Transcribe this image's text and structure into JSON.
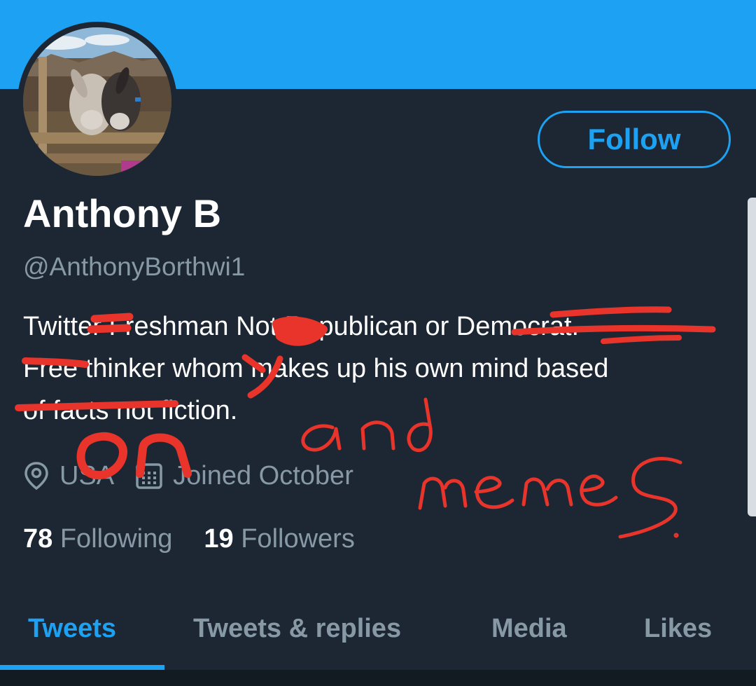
{
  "profile": {
    "display_name": "Anthony B",
    "handle": "@AnthonyBorthwi1",
    "bio_lines": [
      "Twitter Freshman Not Republican or Democrat.",
      "Free thinker whom makes up his own mind based",
      "of facts not fiction."
    ],
    "location": "USA",
    "joined": "Joined October",
    "location_icon": "map-pin-icon",
    "calendar_icon": "calendar-icon"
  },
  "actions": {
    "follow_label": "Follow"
  },
  "stats": {
    "following_count": "78",
    "following_label": "Following",
    "followers_count": "19",
    "followers_label": "Followers"
  },
  "tabs": [
    {
      "label": "Tweets",
      "active": true
    },
    {
      "label": "Tweets & replies",
      "active": false
    },
    {
      "label": "Media",
      "active": false
    },
    {
      "label": "Likes",
      "active": false
    }
  ],
  "handwriting": {
    "word_on": "on",
    "word_and": "and",
    "word_memes": "memes.",
    "color": "#e8342a"
  },
  "colors": {
    "accent": "#1da1f2",
    "background": "#1c2733",
    "muted_text": "#8899a6"
  }
}
